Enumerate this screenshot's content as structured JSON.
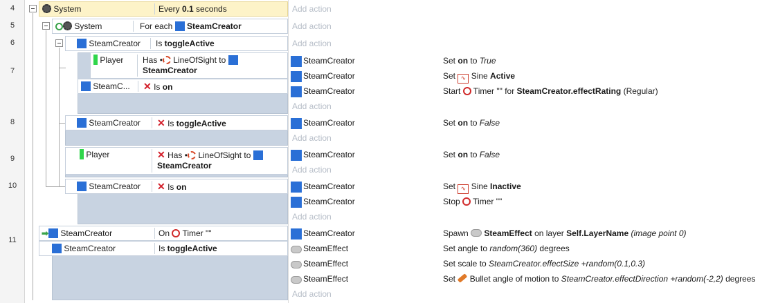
{
  "line_numbers": [
    "4",
    "5",
    "6",
    "7",
    "8",
    "9",
    "10",
    "11"
  ],
  "events": {
    "e4": {
      "cond": {
        "object": "System",
        "text_pre": "Every ",
        "bold": "0.1",
        "text_post": " seconds"
      },
      "add_action": "Add action"
    },
    "e5": {
      "cond": {
        "object": "System",
        "text_pre": "For each ",
        "bold": "SteamCreator"
      },
      "add_action": "Add action"
    },
    "e6": {
      "cond": {
        "object": "SteamCreator",
        "text_pre": "Is ",
        "bold": "toggleActive"
      },
      "add_action": "Add action"
    },
    "e7": {
      "cond1": {
        "object": "Player",
        "text_pre": "Has ",
        "behavior": "LineOfSight to",
        "bold": "SteamCreator"
      },
      "cond2": {
        "object": "SteamC...",
        "text_pre": "Is ",
        "bold": "on"
      },
      "actions": [
        {
          "object": "SteamCreator",
          "pre": "Set ",
          "b1": "on",
          "mid": " to ",
          "i1": "True"
        },
        {
          "object": "SteamCreator",
          "pre": "Set ",
          "mid": " Sine ",
          "b1": "Active"
        },
        {
          "object": "SteamCreator",
          "pre": "Start ",
          "mid": " Timer \"\" for ",
          "b1": "SteamCreator.effectRating",
          "post": " (Regular)"
        }
      ],
      "add_action": "Add action"
    },
    "e8": {
      "cond": {
        "object": "SteamCreator",
        "text_pre": "Is ",
        "bold": "toggleActive"
      },
      "actions": [
        {
          "object": "SteamCreator",
          "pre": "Set ",
          "b1": "on",
          "mid": " to ",
          "i1": "False"
        }
      ],
      "add_action": "Add action"
    },
    "e9": {
      "cond": {
        "object": "Player",
        "text_pre": "Has ",
        "behavior": "LineOfSight to",
        "bold": "SteamCreator"
      },
      "actions": [
        {
          "object": "SteamCreator",
          "pre": "Set ",
          "b1": "on",
          "mid": " to ",
          "i1": "False"
        }
      ],
      "add_action": "Add action"
    },
    "e10": {
      "cond": {
        "object": "SteamCreator",
        "text_pre": "Is ",
        "bold": "on"
      },
      "actions": [
        {
          "object": "SteamCreator",
          "pre": "Set ",
          "mid": " Sine ",
          "b1": "Inactive"
        },
        {
          "object": "SteamCreator",
          "pre": "Stop ",
          "mid": " Timer \"\""
        }
      ],
      "add_action": "Add action"
    },
    "e11": {
      "cond1": {
        "object": "SteamCreator",
        "text_pre": "On ",
        "text_post": " Timer \"\""
      },
      "cond2": {
        "object": "SteamCreator",
        "text_pre": "Is ",
        "bold": "toggleActive"
      },
      "actions": [
        {
          "object": "SteamCreator",
          "pre": "Spawn ",
          "b1": "SteamEffect",
          "mid": " on layer ",
          "b2": "Self.LayerName",
          "i1": "(image point 0)"
        },
        {
          "object": "SteamEffect",
          "pre": "Set angle to ",
          "i1": "random(360)",
          "post": " degrees"
        },
        {
          "object": "SteamEffect",
          "pre": "Set scale to ",
          "i1": "SteamCreator.effectSize +random(0.1,0.3)"
        },
        {
          "object": "SteamEffect",
          "pre": "Set ",
          "mid": " Bullet angle of motion to ",
          "i1": "SteamCreator.effectDirection +random(-2,2)",
          "post": "  degrees"
        }
      ],
      "add_action": "Add action"
    }
  },
  "colors": {
    "object_icon": "#2a6fd6",
    "player_icon": "#30d64b",
    "system_bg": "#fdf3c8",
    "event_bg": "#c8d3e1",
    "add_action": "#b7bec8"
  }
}
